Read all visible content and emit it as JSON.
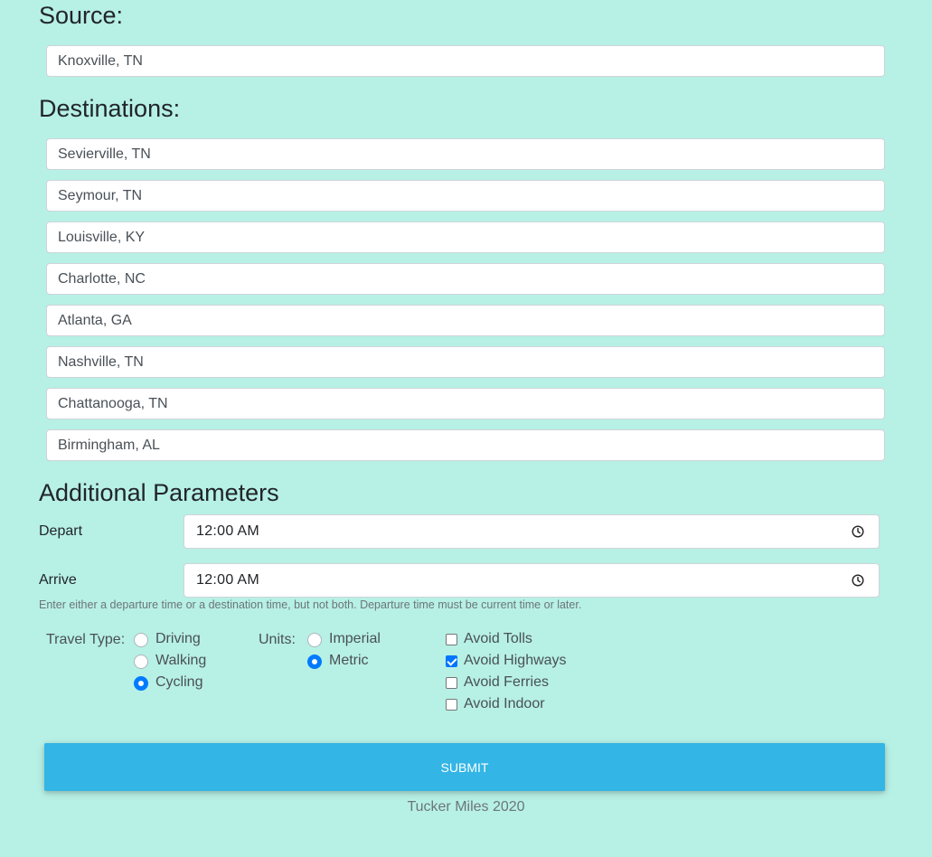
{
  "source": {
    "heading": "Source:",
    "value": "Knoxville, TN"
  },
  "destinations": {
    "heading": "Destinations:",
    "items": [
      "Sevierville, TN",
      "Seymour, TN",
      "Louisville, KY",
      "Charlotte, NC",
      "Atlanta, GA",
      "Nashville, TN",
      "Chattanooga, TN",
      "Birmingham, AL"
    ]
  },
  "params": {
    "heading": "Additional Parameters",
    "depart_label": "Depart",
    "depart_value": "12:00 AM",
    "arrive_label": "Arrive",
    "arrive_value": "12:00 AM",
    "help_text": "Enter either a departure time or a destination time, but not both. Departure time must be current time or later.",
    "clock_icon": "clock-icon"
  },
  "travel_type": {
    "label": "Travel Type:",
    "options": [
      {
        "label": "Driving",
        "checked": false
      },
      {
        "label": "Walking",
        "checked": false
      },
      {
        "label": "Cycling",
        "checked": true
      }
    ]
  },
  "units": {
    "label": "Units:",
    "options": [
      {
        "label": "Imperial",
        "checked": false
      },
      {
        "label": "Metric",
        "checked": true
      }
    ]
  },
  "avoid": {
    "options": [
      {
        "label": "Avoid Tolls",
        "checked": false
      },
      {
        "label": "Avoid Highways",
        "checked": true
      },
      {
        "label": "Avoid Ferries",
        "checked": false
      },
      {
        "label": "Avoid Indoor",
        "checked": false
      }
    ]
  },
  "submit_label": "Submit",
  "footer": "Tucker Miles 2020",
  "colors": {
    "background": "#b7f0e5",
    "submit": "#33b5e5",
    "radio_accent": "#007bff",
    "checkbox_accent": "#0075ff"
  }
}
